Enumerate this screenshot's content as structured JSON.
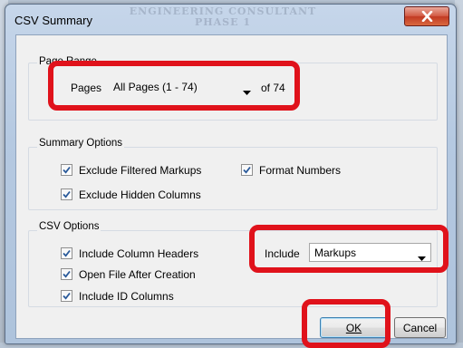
{
  "window": {
    "title": "CSV Summary",
    "watermark_line1": "ENGINEERING CONSULTANT",
    "watermark_line2": "PHASE 1"
  },
  "page_range": {
    "group_label": "Page Range",
    "pages_label": "Pages",
    "pages_value": "All Pages (1 - 74)",
    "of_label": "of 74"
  },
  "summary_options": {
    "group_label": "Summary Options",
    "exclude_filtered_markups": {
      "label": "Exclude Filtered Markups",
      "checked": true
    },
    "format_numbers": {
      "label": "Format Numbers",
      "checked": true
    },
    "exclude_hidden_columns": {
      "label": "Exclude Hidden Columns",
      "checked": true
    }
  },
  "csv_options": {
    "group_label": "CSV Options",
    "include_column_headers": {
      "label": "Include Column Headers",
      "checked": true
    },
    "open_file_after_creation": {
      "label": "Open File After Creation",
      "checked": true
    },
    "include_id_columns": {
      "label": "Include ID Columns",
      "checked": true
    },
    "include_label": "Include",
    "include_value": "Markups"
  },
  "buttons": {
    "ok_label": "OK",
    "cancel_label": "Cancel"
  },
  "colors": {
    "highlight": "#e0121b",
    "close_button": "#c23a23",
    "check_mark": "#2a5a9a"
  },
  "icons": {
    "close": "close-icon",
    "dropdown": "chevron-down-icon",
    "check": "check-icon"
  }
}
